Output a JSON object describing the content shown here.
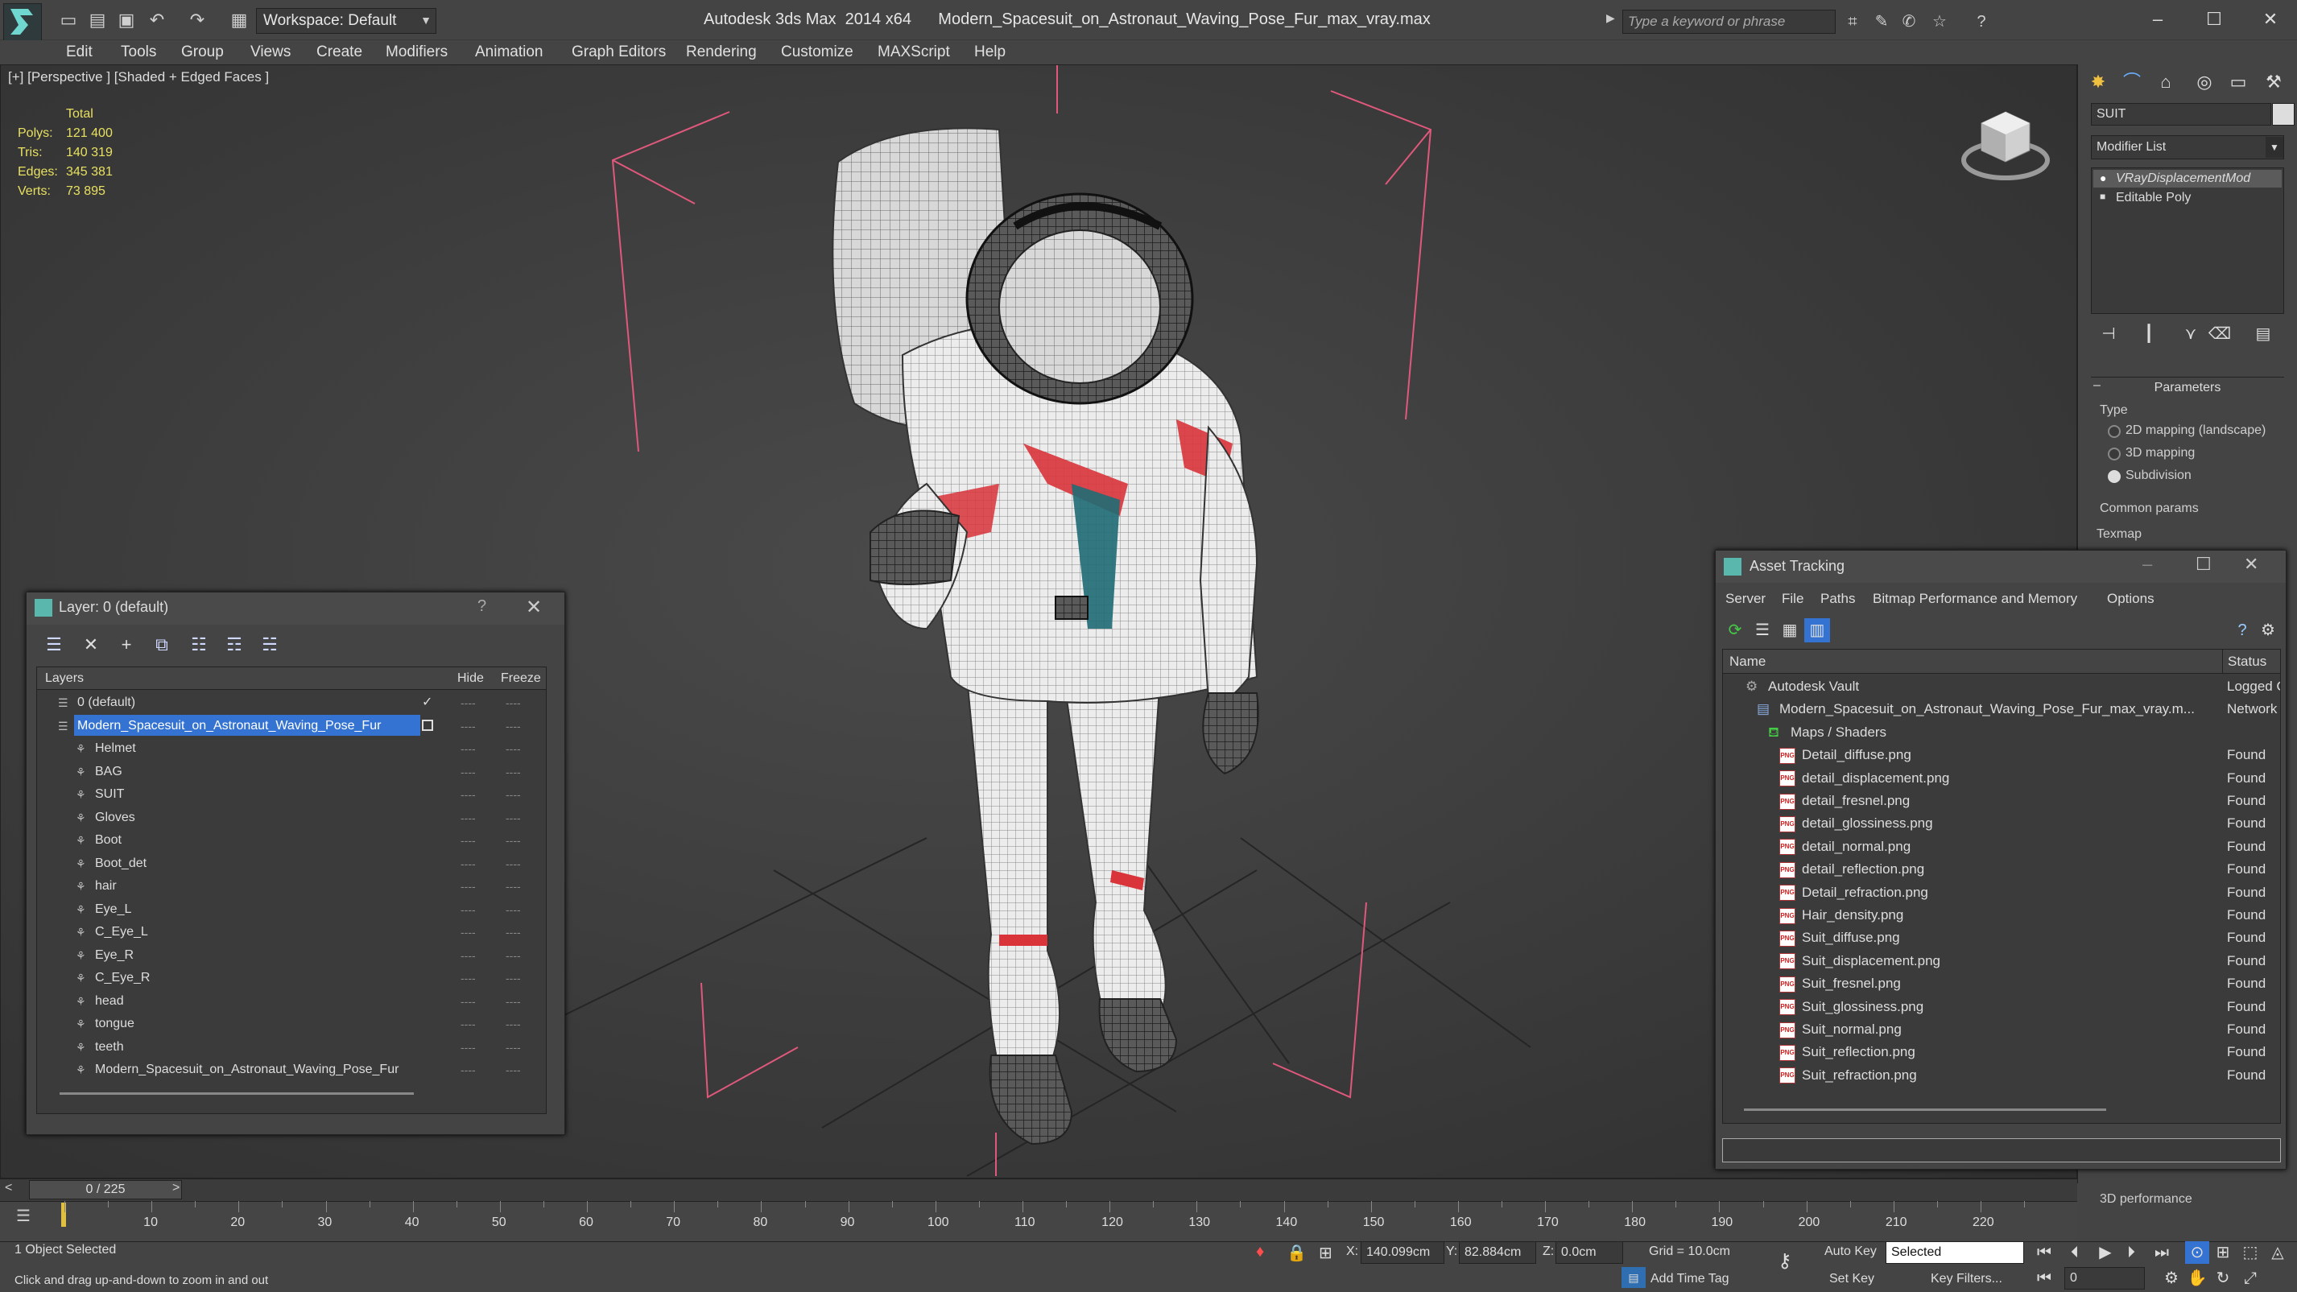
{
  "title_bar": {
    "app_name": "Autodesk 3ds Max  2014 x64",
    "file_name": "Modern_Spacesuit_on_Astronaut_Waving_Pose_Fur_max_vray.max",
    "workspace": "Workspace: Default",
    "search_placeholder": "Type a keyword or phrase"
  },
  "menu": [
    "Edit",
    "Tools",
    "Group",
    "Views",
    "Create",
    "Modifiers",
    "Animation",
    "Graph Editors",
    "Rendering",
    "Customize",
    "MAXScript",
    "Help"
  ],
  "viewport": {
    "label": "[+] [Perspective ] [Shaded + Edged Faces ]",
    "stats": {
      "total_label": "Total",
      "polys_label": "Polys:",
      "polys": "121 400",
      "tris_label": "Tris:",
      "tris": "140 319",
      "edges_label": "Edges:",
      "edges": "345 381",
      "verts_label": "Verts:",
      "verts": "73 895"
    }
  },
  "command_panel": {
    "object_name": "SUIT",
    "modifier_list": "Modifier List",
    "stack": [
      "VRayDisplacementMod",
      "Editable Poly"
    ],
    "parameters_title": "Parameters",
    "type_label": "Type",
    "options": [
      "2D mapping (landscape)",
      "3D mapping",
      "Subdivision"
    ],
    "selected_option": "Subdivision",
    "common_params": "Common params",
    "texmap": "Texmap",
    "performance": "3D performance"
  },
  "layer_window": {
    "title": "Layer: 0 (default)",
    "help": "?",
    "columns": {
      "layers": "Layers",
      "hide": "Hide",
      "freeze": "Freeze"
    },
    "layers": [
      {
        "name": "0 (default)",
        "level": 0,
        "current": true,
        "selected": false
      },
      {
        "name": "Modern_Spacesuit_on_Astronaut_Waving_Pose_Fur",
        "level": 0,
        "current": false,
        "selected": true
      },
      {
        "name": "Helmet",
        "level": 1
      },
      {
        "name": "BAG",
        "level": 1
      },
      {
        "name": "SUIT",
        "level": 1
      },
      {
        "name": "Gloves",
        "level": 1
      },
      {
        "name": "Boot",
        "level": 1
      },
      {
        "name": "Boot_det",
        "level": 1
      },
      {
        "name": "hair",
        "level": 1
      },
      {
        "name": "Eye_L",
        "level": 1
      },
      {
        "name": "C_Eye_L",
        "level": 1
      },
      {
        "name": "Eye_R",
        "level": 1
      },
      {
        "name": "C_Eye_R",
        "level": 1
      },
      {
        "name": "head",
        "level": 1
      },
      {
        "name": "tongue",
        "level": 1
      },
      {
        "name": "teeth",
        "level": 1
      },
      {
        "name": "Modern_Spacesuit_on_Astronaut_Waving_Pose_Fur",
        "level": 1
      }
    ]
  },
  "asset_window": {
    "title": "Asset Tracking",
    "menu": [
      "Server",
      "File",
      "Paths",
      "Bitmap Performance and Memory",
      "Options"
    ],
    "columns": {
      "name": "Name",
      "status": "Status"
    },
    "rows": [
      {
        "name": "Autodesk Vault",
        "status": "Logged Out",
        "level": 1,
        "kind": "vault"
      },
      {
        "name": "Modern_Spacesuit_on_Astronaut_Waving_Pose_Fur_max_vray.m...",
        "status": "Network",
        "level": 2,
        "kind": "max"
      },
      {
        "name": "Maps / Shaders",
        "status": "",
        "level": 3,
        "kind": "maps"
      },
      {
        "name": "Detail_diffuse.png",
        "status": "Found",
        "level": 4,
        "kind": "png"
      },
      {
        "name": "detail_displacement.png",
        "status": "Found",
        "level": 4,
        "kind": "png"
      },
      {
        "name": "detail_fresnel.png",
        "status": "Found",
        "level": 4,
        "kind": "png"
      },
      {
        "name": "detail_glossiness.png",
        "status": "Found",
        "level": 4,
        "kind": "png"
      },
      {
        "name": "detail_normal.png",
        "status": "Found",
        "level": 4,
        "kind": "png"
      },
      {
        "name": "detail_reflection.png",
        "status": "Found",
        "level": 4,
        "kind": "png"
      },
      {
        "name": "Detail_refraction.png",
        "status": "Found",
        "level": 4,
        "kind": "png"
      },
      {
        "name": "Hair_density.png",
        "status": "Found",
        "level": 4,
        "kind": "png"
      },
      {
        "name": "Suit_diffuse.png",
        "status": "Found",
        "level": 4,
        "kind": "png"
      },
      {
        "name": "Suit_displacement.png",
        "status": "Found",
        "level": 4,
        "kind": "png"
      },
      {
        "name": "Suit_fresnel.png",
        "status": "Found",
        "level": 4,
        "kind": "png"
      },
      {
        "name": "Suit_glossiness.png",
        "status": "Found",
        "level": 4,
        "kind": "png"
      },
      {
        "name": "Suit_normal.png",
        "status": "Found",
        "level": 4,
        "kind": "png"
      },
      {
        "name": "Suit_reflection.png",
        "status": "Found",
        "level": 4,
        "kind": "png"
      },
      {
        "name": "Suit_refraction.png",
        "status": "Found",
        "level": 4,
        "kind": "png"
      }
    ]
  },
  "timeline": {
    "frame_display": "0 / 225",
    "ticks": [
      "10",
      "20",
      "30",
      "40",
      "50",
      "60",
      "70",
      "80",
      "90",
      "100",
      "110",
      "120",
      "130",
      "140",
      "150",
      "160",
      "170",
      "180",
      "190",
      "200",
      "210",
      "220"
    ]
  },
  "status_bar": {
    "selection": "1 Object Selected",
    "prompt": "Click and drag up-and-down to zoom in and out",
    "x_label": "X:",
    "x_value": "140.099cm",
    "y_label": "Y:",
    "y_value": "82.884cm",
    "z_label": "Z:",
    "z_value": "0.0cm",
    "grid": "Grid = 10.0cm",
    "auto_key": "Auto Key",
    "set_key": "Set Key",
    "selected_dropdown": "Selected",
    "key_filters": "Key Filters...",
    "add_time_tag": "Add Time Tag",
    "frame_field": "0"
  },
  "colors": {
    "selection_blue": "#3473d1",
    "stats_yellow": "#e8e060",
    "gizmo_red": "#e0587c",
    "suit_red": "#d8343a",
    "suit_teal": "#1f6c74"
  }
}
